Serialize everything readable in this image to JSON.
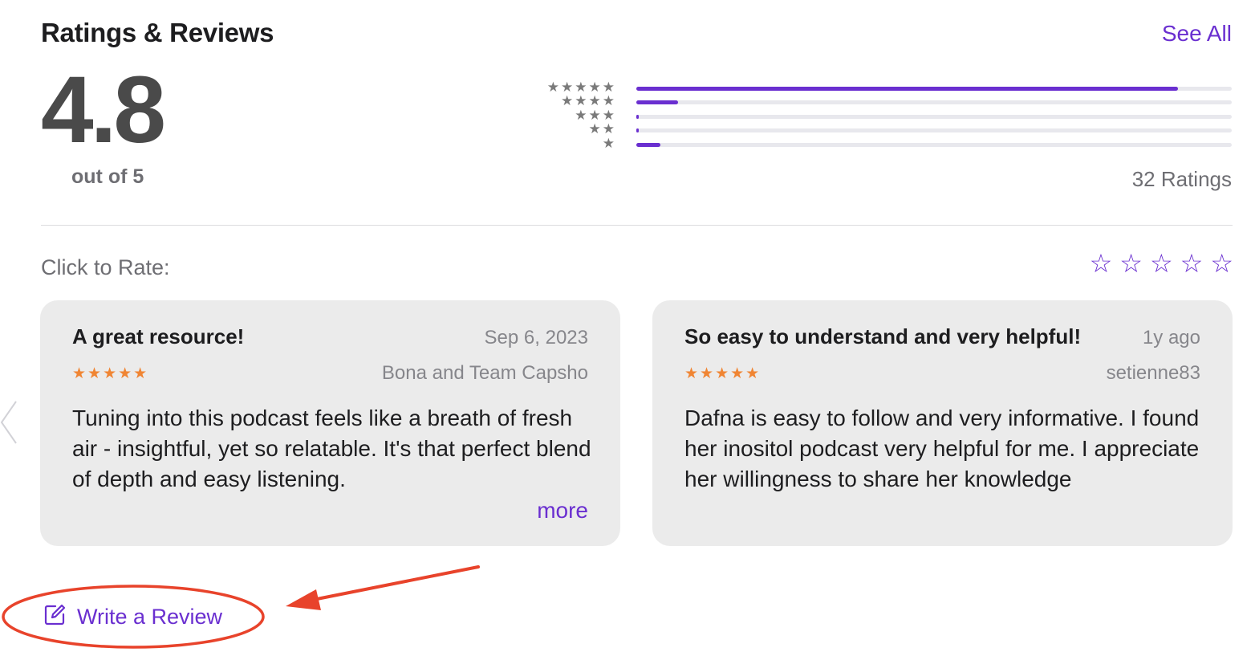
{
  "header": {
    "title": "Ratings & Reviews",
    "see_all": "See All"
  },
  "summary": {
    "average": "4.8",
    "out_of": "out of 5",
    "ratings_count": "32 Ratings",
    "star_labels": [
      "★★★★★",
      "★★★★",
      "★★★",
      "★★",
      "★"
    ],
    "distribution_fraction": [
      0.91,
      0.07,
      0.004,
      0.004,
      0.04
    ]
  },
  "rate": {
    "label": "Click to Rate:",
    "star_glyph": "☆"
  },
  "reviews": [
    {
      "title": "A great resource!",
      "date": "Sep 6, 2023",
      "stars": "★★★★★",
      "author": "Bona and Team Capsho",
      "body": "Tuning into this podcast feels like a breath of fresh air - insightful, yet so relatable. It's that perfect blend of depth and easy listening.",
      "more": "more"
    },
    {
      "title": "So easy to understand and very helpful!",
      "date": "1y ago",
      "stars": "★★★★★",
      "author": "setienne83",
      "body": "Dafna is easy to follow and very informative. I found her inositol podcast very helpful for me. I appreciate her willingness to share her knowledge"
    }
  ],
  "write_review": {
    "label": "Write a Review",
    "icon": "compose-icon"
  },
  "colors": {
    "accent": "#6a2fd0",
    "review_stars": "#f08533",
    "annotation": "#e8432b"
  }
}
